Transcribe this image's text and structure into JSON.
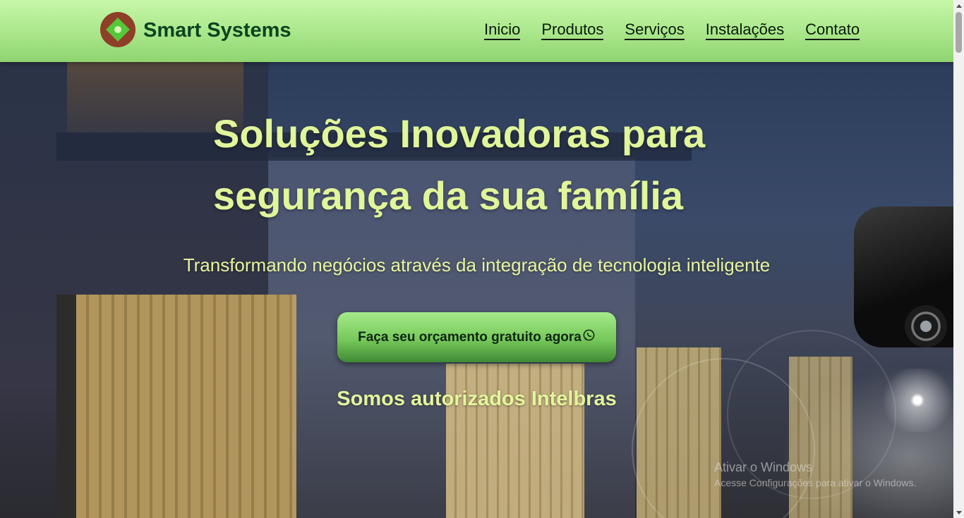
{
  "header": {
    "brand_name": "Smart Systems",
    "nav": [
      {
        "label": "Inicio"
      },
      {
        "label": "Produtos"
      },
      {
        "label": "Serviços"
      },
      {
        "label": "Instalações"
      },
      {
        "label": "Contato"
      }
    ]
  },
  "hero": {
    "title": "Soluções Inovadoras para segurança da sua família",
    "subtitle": "Transformando negócios através da integração de tecnologia inteligente",
    "cta_label": "Faça seu orçamento gratuito agora",
    "cta_icon": "whatsapp-icon",
    "authorized": "Somos autorizados Intelbras"
  },
  "watermark": {
    "title": "Ativar o Windows",
    "text": "Acesse Configurações para ativar o Windows."
  },
  "colors": {
    "header_bg": "#b5ec97",
    "brand_text": "#0c4420",
    "hero_text": "#e1f59a",
    "cta_bg": "#76c95a",
    "logo_bg": "#8e3f28"
  }
}
